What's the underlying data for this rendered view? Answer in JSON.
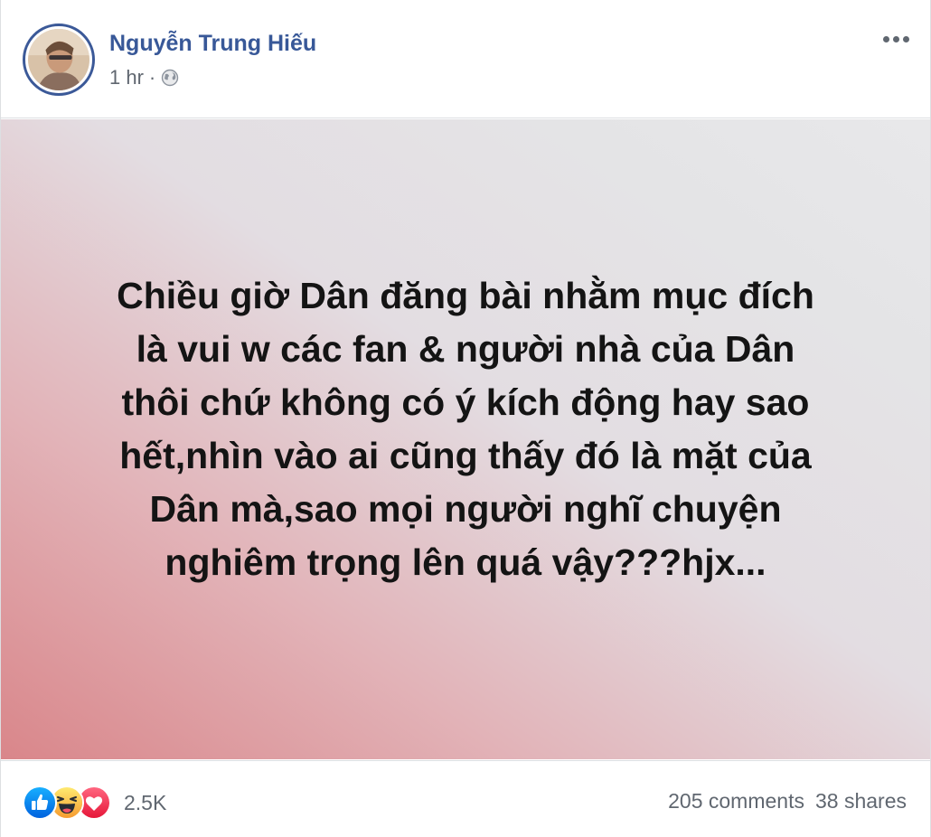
{
  "post": {
    "author": {
      "name": "Nguyễn Trung Hiếu"
    },
    "timestamp": "1 hr",
    "separator": "·",
    "privacy_icon": "globe-icon",
    "more_icon": "more-options-icon",
    "status_text": "Chiều giờ Dân đăng bài nhằm mục đích\nlà vui w các fan & người nhà của Dân\nthôi chứ không có ý kích động hay sao\nhết,nhìn vào ai cũng thấy đó là mặt của\nDân mà,sao mọi người nghĩ chuyện\nnghiêm trọng lên quá vậy???hjx...",
    "background_colors": {
      "bottom_left": "#d9868a",
      "middle": "#e3dde2",
      "top_right": "#e8e8ea"
    }
  },
  "footer": {
    "reactions": [
      "like-icon",
      "haha-icon",
      "love-icon"
    ],
    "reaction_count": "2.5K",
    "comments": "205 comments",
    "shares": "38 shares"
  },
  "colors": {
    "link_blue": "#385898",
    "meta_gray": "#606770",
    "like_blue": "#1877f2",
    "love_red": "#f33e58",
    "haha_yellow": "#f7b125"
  }
}
